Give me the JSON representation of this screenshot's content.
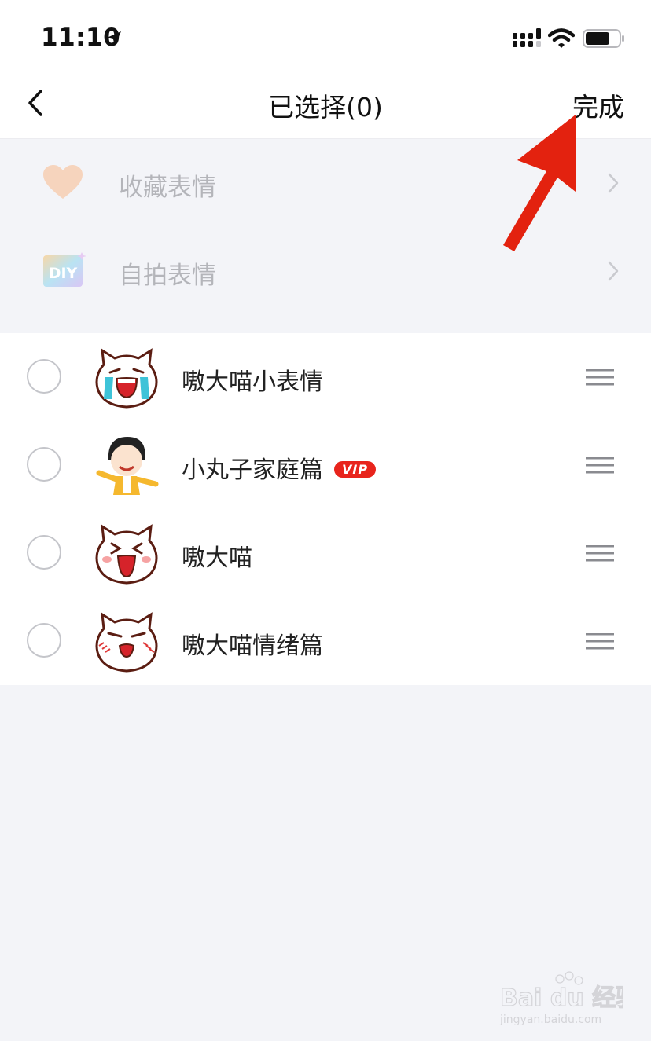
{
  "status_bar": {
    "time": "11:10"
  },
  "nav": {
    "title": "已选择(0)",
    "done_label": "完成"
  },
  "special_items": [
    {
      "label": "收藏表情",
      "icon": "heart-icon"
    },
    {
      "label": "自拍表情",
      "icon": "diy-icon"
    }
  ],
  "packs": [
    {
      "name": "嗷大喵小表情",
      "vip": ""
    },
    {
      "name": "小丸子家庭篇",
      "vip": "VIP"
    },
    {
      "name": "嗷大喵",
      "vip": ""
    },
    {
      "name": "嗷大喵情绪篇",
      "vip": ""
    }
  ],
  "watermark": {
    "brand": "Bai du 经验",
    "url": "jingyan.baidu.com"
  },
  "colors": {
    "accent_red": "#e8241c",
    "background": "#f3f4f8",
    "heart": "#f6d4bd"
  }
}
